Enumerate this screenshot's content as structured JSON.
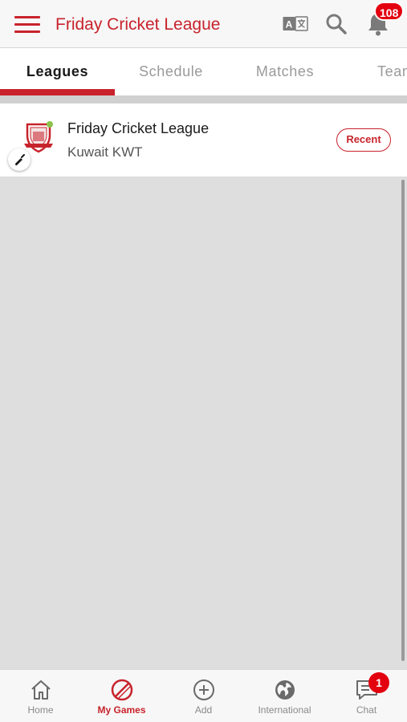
{
  "header": {
    "title": "Friday Cricket League",
    "notification_count": "108",
    "icons": [
      "menu-icon",
      "translate-icon",
      "search-icon",
      "bell-icon"
    ]
  },
  "tabs": [
    {
      "label": "Leagues",
      "active": true
    },
    {
      "label": "Schedule",
      "active": false
    },
    {
      "label": "Matches",
      "active": false
    },
    {
      "label": "Teams",
      "active": false
    }
  ],
  "league": {
    "name": "Friday Cricket League",
    "location": "Kuwait KWT",
    "action_label": "Recent"
  },
  "bottom_nav": {
    "items": [
      {
        "label": "Home",
        "icon": "home-icon",
        "active": false
      },
      {
        "label": "My Games",
        "icon": "my-games-icon",
        "active": true
      },
      {
        "label": "Add",
        "icon": "add-icon",
        "active": false
      },
      {
        "label": "International",
        "icon": "globe-icon",
        "active": false
      },
      {
        "label": "Chat",
        "icon": "chat-icon",
        "active": false
      }
    ],
    "chat_badge": "1"
  },
  "colors": {
    "accent": "#c8232c",
    "badge": "#e3000f",
    "background": "#dedede"
  }
}
